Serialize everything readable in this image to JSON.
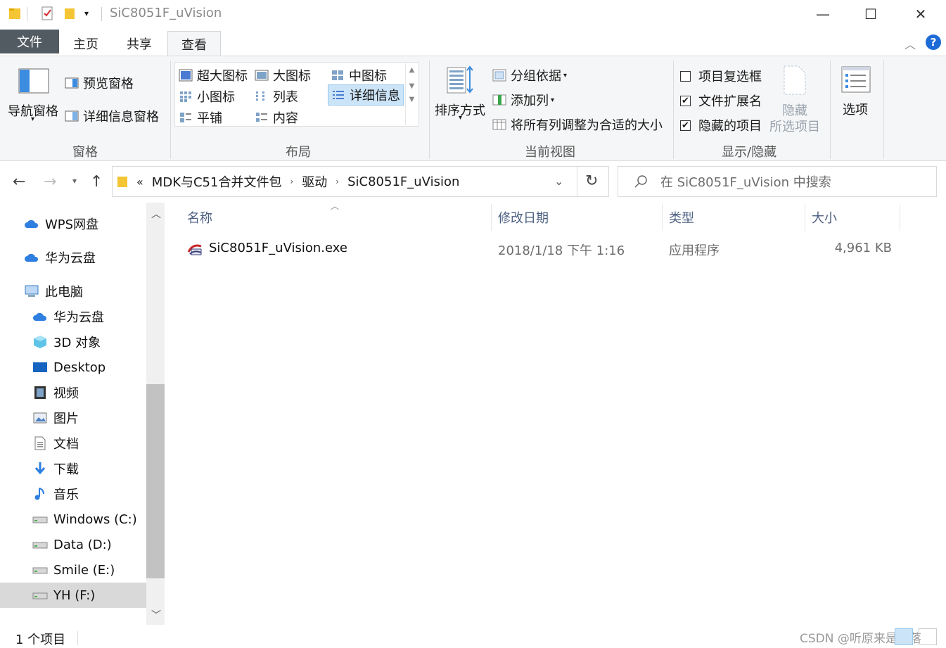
{
  "window": {
    "title": "SiC8051F_uVision",
    "minimize": "—",
    "maximize": "☐",
    "close": "✕"
  },
  "tabs": {
    "file": "文件",
    "home": "主页",
    "share": "共享",
    "view": "查看"
  },
  "ribbon": {
    "panes": {
      "nav_pane": "导航窗格",
      "preview_pane": "预览窗格",
      "details_pane": "详细信息窗格",
      "group": "窗格"
    },
    "layout": {
      "extra_large": "超大图标",
      "large": "大图标",
      "medium": "中图标",
      "small": "小图标",
      "list": "列表",
      "details": "详细信息",
      "tiles": "平铺",
      "content": "内容",
      "group": "布局"
    },
    "current_view": {
      "sort_by": "排序方式",
      "group_by": "分组依据",
      "add_columns": "添加列",
      "size_all_columns": "将所有列调整为合适的大小",
      "group": "当前视图"
    },
    "show_hide": {
      "item_checkboxes": "项目复选框",
      "item_checkboxes_checked": false,
      "file_extensions": "文件扩展名",
      "file_extensions_checked": true,
      "hidden_items": "隐藏的项目",
      "hidden_items_checked": true,
      "hide_selected_1": "隐藏",
      "hide_selected_2": "所选项目",
      "group": "显示/隐藏"
    },
    "options": "选项"
  },
  "address": {
    "overflow": "«",
    "crumbs": [
      "MDK与C51合并文件包",
      "驱动",
      "SiC8051F_uVision"
    ],
    "search_placeholder": "在 SiC8051F_uVision 中搜索"
  },
  "nav": {
    "items": [
      {
        "label": "WPS网盘",
        "icon": "cloud-icon"
      },
      {
        "label": "华为云盘",
        "icon": "cloud-icon"
      },
      {
        "label": "此电脑",
        "icon": "computer-icon"
      },
      {
        "label": "华为云盘",
        "icon": "cloud-icon"
      },
      {
        "label": "3D 对象",
        "icon": "cube-icon"
      },
      {
        "label": "Desktop",
        "icon": "desktop-icon"
      },
      {
        "label": "视频",
        "icon": "video-icon"
      },
      {
        "label": "图片",
        "icon": "picture-icon"
      },
      {
        "label": "文档",
        "icon": "document-icon"
      },
      {
        "label": "下载",
        "icon": "download-icon"
      },
      {
        "label": "音乐",
        "icon": "music-icon"
      },
      {
        "label": "Windows (C:)",
        "icon": "drive-icon"
      },
      {
        "label": "Data (D:)",
        "icon": "drive-icon"
      },
      {
        "label": "Smile (E:)",
        "icon": "drive-icon"
      },
      {
        "label": "YH (F:)",
        "icon": "drive-icon"
      }
    ]
  },
  "columns": {
    "name": "名称",
    "modified": "修改日期",
    "type": "类型",
    "size": "大小"
  },
  "files": [
    {
      "name": "SiC8051F_uVision.exe",
      "modified": "2018/1/18 下午 1:16",
      "type": "应用程序",
      "size": "4,961 KB"
    }
  ],
  "status": {
    "count": "1 个项目"
  },
  "watermark": "CSDN @听原来是雨落",
  "colors": {
    "file_tab": "#535b62",
    "ribbon_bg": "#f5f6f7",
    "selected_layout": "#cce4f7",
    "column_header_text": "#4d6082",
    "help_blue": "#1d6bd6"
  }
}
